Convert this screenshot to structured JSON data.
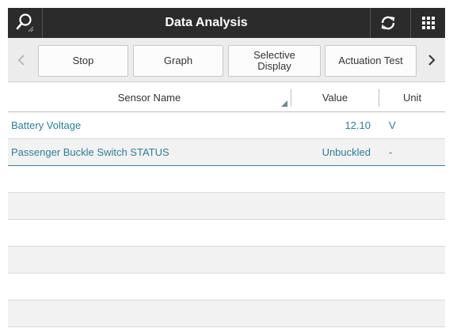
{
  "header": {
    "title": "Data Analysis",
    "search_icon": "search-icon",
    "refresh_icon": "refresh-icon",
    "menu_icon": "grid-menu-icon"
  },
  "toolbar": {
    "prev_icon": "chevron-left-icon",
    "next_icon": "chevron-right-icon",
    "buttons": [
      {
        "label": "Stop"
      },
      {
        "label": "Graph"
      },
      {
        "label": "Selective\nDisplay"
      },
      {
        "label": "Actuation Test"
      }
    ]
  },
  "table": {
    "columns": {
      "name": "Sensor Name",
      "value": "Value",
      "unit": "Unit"
    },
    "rows": [
      {
        "name": "Battery Voltage",
        "value": "12.10",
        "unit": "V"
      },
      {
        "name": "Passenger Buckle Switch STATUS",
        "value": "Unbuckled",
        "unit": "-"
      },
      {
        "name": "",
        "value": "",
        "unit": ""
      },
      {
        "name": "",
        "value": "",
        "unit": ""
      },
      {
        "name": "",
        "value": "",
        "unit": ""
      },
      {
        "name": "",
        "value": "",
        "unit": ""
      },
      {
        "name": "",
        "value": "",
        "unit": ""
      },
      {
        "name": "",
        "value": "",
        "unit": ""
      }
    ]
  },
  "colors": {
    "titlebar": "#2b2b2b",
    "accent_text": "#2a7f98",
    "toolbar_bg": "#ececec"
  }
}
